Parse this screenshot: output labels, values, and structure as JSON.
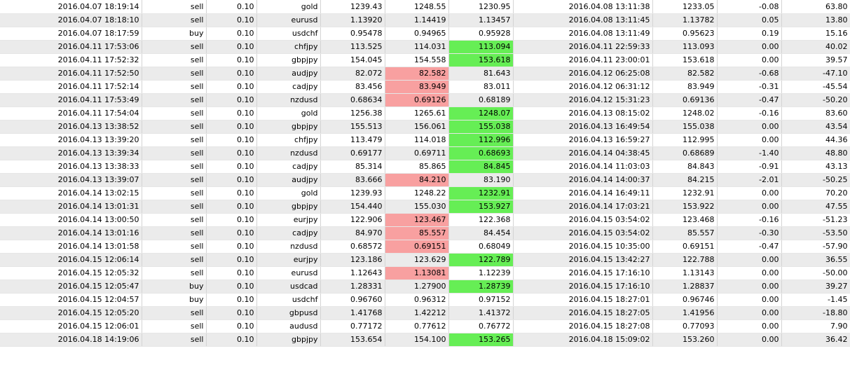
{
  "rows": [
    {
      "open_time": "2016.04.07 18:19:14",
      "type": "sell",
      "size": "0.10",
      "symbol": "gold",
      "price": "1239.43",
      "sl": "1248.55",
      "tp": "1230.95",
      "close_time": "2016.04.08 13:11:38",
      "close_price": "1233.05",
      "swap": "-0.08",
      "profit": "63.80",
      "hl": ""
    },
    {
      "open_time": "2016.04.07 18:18:10",
      "type": "sell",
      "size": "0.10",
      "symbol": "eurusd",
      "price": "1.13920",
      "sl": "1.14419",
      "tp": "1.13457",
      "close_time": "2016.04.08 13:11:45",
      "close_price": "1.13782",
      "swap": "0.05",
      "profit": "13.80",
      "hl": ""
    },
    {
      "open_time": "2016.04.07 18:17:59",
      "type": "buy",
      "size": "0.10",
      "symbol": "usdchf",
      "price": "0.95478",
      "sl": "0.94965",
      "tp": "0.95928",
      "close_time": "2016.04.08 13:11:49",
      "close_price": "0.95623",
      "swap": "0.19",
      "profit": "15.16",
      "hl": ""
    },
    {
      "open_time": "2016.04.11 17:53:06",
      "type": "sell",
      "size": "0.10",
      "symbol": "chfjpy",
      "price": "113.525",
      "sl": "114.031",
      "tp": "113.094",
      "close_time": "2016.04.11 22:59:33",
      "close_price": "113.093",
      "swap": "0.00",
      "profit": "40.02",
      "hl": "tp"
    },
    {
      "open_time": "2016.04.11 17:52:32",
      "type": "sell",
      "size": "0.10",
      "symbol": "gbpjpy",
      "price": "154.045",
      "sl": "154.558",
      "tp": "153.618",
      "close_time": "2016.04.11 23:00:01",
      "close_price": "153.618",
      "swap": "0.00",
      "profit": "39.57",
      "hl": "tp"
    },
    {
      "open_time": "2016.04.11 17:52:50",
      "type": "sell",
      "size": "0.10",
      "symbol": "audjpy",
      "price": "82.072",
      "sl": "82.582",
      "tp": "81.643",
      "close_time": "2016.04.12 06:25:08",
      "close_price": "82.582",
      "swap": "-0.68",
      "profit": "-47.10",
      "hl": "sl"
    },
    {
      "open_time": "2016.04.11 17:52:14",
      "type": "sell",
      "size": "0.10",
      "symbol": "cadjpy",
      "price": "83.456",
      "sl": "83.949",
      "tp": "83.011",
      "close_time": "2016.04.12 06:31:12",
      "close_price": "83.949",
      "swap": "-0.31",
      "profit": "-45.54",
      "hl": "sl"
    },
    {
      "open_time": "2016.04.11 17:53:49",
      "type": "sell",
      "size": "0.10",
      "symbol": "nzdusd",
      "price": "0.68634",
      "sl": "0.69126",
      "tp": "0.68189",
      "close_time": "2016.04.12 15:31:23",
      "close_price": "0.69136",
      "swap": "-0.47",
      "profit": "-50.20",
      "hl": "sl"
    },
    {
      "open_time": "2016.04.11 17:54:04",
      "type": "sell",
      "size": "0.10",
      "symbol": "gold",
      "price": "1256.38",
      "sl": "1265.61",
      "tp": "1248.07",
      "close_time": "2016.04.13 08:15:02",
      "close_price": "1248.02",
      "swap": "-0.16",
      "profit": "83.60",
      "hl": "tp"
    },
    {
      "open_time": "2016.04.13 13:38:52",
      "type": "sell",
      "size": "0.10",
      "symbol": "gbpjpy",
      "price": "155.513",
      "sl": "156.061",
      "tp": "155.038",
      "close_time": "2016.04.13 16:49:54",
      "close_price": "155.038",
      "swap": "0.00",
      "profit": "43.54",
      "hl": "tp"
    },
    {
      "open_time": "2016.04.13 13:39:20",
      "type": "sell",
      "size": "0.10",
      "symbol": "chfjpy",
      "price": "113.479",
      "sl": "114.018",
      "tp": "112.996",
      "close_time": "2016.04.13 16:59:27",
      "close_price": "112.995",
      "swap": "0.00",
      "profit": "44.36",
      "hl": "tp"
    },
    {
      "open_time": "2016.04.13 13:39:34",
      "type": "sell",
      "size": "0.10",
      "symbol": "nzdusd",
      "price": "0.69177",
      "sl": "0.69711",
      "tp": "0.68693",
      "close_time": "2016.04.14 04:38:45",
      "close_price": "0.68689",
      "swap": "-1.40",
      "profit": "48.80",
      "hl": "tp"
    },
    {
      "open_time": "2016.04.13 13:38:33",
      "type": "sell",
      "size": "0.10",
      "symbol": "cadjpy",
      "price": "85.314",
      "sl": "85.865",
      "tp": "84.845",
      "close_time": "2016.04.14 11:03:03",
      "close_price": "84.843",
      "swap": "-0.91",
      "profit": "43.13",
      "hl": "tp"
    },
    {
      "open_time": "2016.04.13 13:39:07",
      "type": "sell",
      "size": "0.10",
      "symbol": "audjpy",
      "price": "83.666",
      "sl": "84.210",
      "tp": "83.190",
      "close_time": "2016.04.14 14:00:37",
      "close_price": "84.215",
      "swap": "-2.01",
      "profit": "-50.25",
      "hl": "sl"
    },
    {
      "open_time": "2016.04.14 13:02:15",
      "type": "sell",
      "size": "0.10",
      "symbol": "gold",
      "price": "1239.93",
      "sl": "1248.22",
      "tp": "1232.91",
      "close_time": "2016.04.14 16:49:11",
      "close_price": "1232.91",
      "swap": "0.00",
      "profit": "70.20",
      "hl": "tp"
    },
    {
      "open_time": "2016.04.14 13:01:31",
      "type": "sell",
      "size": "0.10",
      "symbol": "gbpjpy",
      "price": "154.440",
      "sl": "155.030",
      "tp": "153.927",
      "close_time": "2016.04.14 17:03:21",
      "close_price": "153.922",
      "swap": "0.00",
      "profit": "47.55",
      "hl": "tp"
    },
    {
      "open_time": "2016.04.14 13:00:50",
      "type": "sell",
      "size": "0.10",
      "symbol": "eurjpy",
      "price": "122.906",
      "sl": "123.467",
      "tp": "122.368",
      "close_time": "2016.04.15 03:54:02",
      "close_price": "123.468",
      "swap": "-0.16",
      "profit": "-51.23",
      "hl": "sl"
    },
    {
      "open_time": "2016.04.14 13:01:16",
      "type": "sell",
      "size": "0.10",
      "symbol": "cadjpy",
      "price": "84.970",
      "sl": "85.557",
      "tp": "84.454",
      "close_time": "2016.04.15 03:54:02",
      "close_price": "85.557",
      "swap": "-0.30",
      "profit": "-53.50",
      "hl": "sl"
    },
    {
      "open_time": "2016.04.14 13:01:58",
      "type": "sell",
      "size": "0.10",
      "symbol": "nzdusd",
      "price": "0.68572",
      "sl": "0.69151",
      "tp": "0.68049",
      "close_time": "2016.04.15 10:35:00",
      "close_price": "0.69151",
      "swap": "-0.47",
      "profit": "-57.90",
      "hl": "sl"
    },
    {
      "open_time": "2016.04.15 12:06:14",
      "type": "sell",
      "size": "0.10",
      "symbol": "eurjpy",
      "price": "123.186",
      "sl": "123.629",
      "tp": "122.789",
      "close_time": "2016.04.15 13:42:27",
      "close_price": "122.788",
      "swap": "0.00",
      "profit": "36.55",
      "hl": "tp"
    },
    {
      "open_time": "2016.04.15 12:05:32",
      "type": "sell",
      "size": "0.10",
      "symbol": "eurusd",
      "price": "1.12643",
      "sl": "1.13081",
      "tp": "1.12239",
      "close_time": "2016.04.15 17:16:10",
      "close_price": "1.13143",
      "swap": "0.00",
      "profit": "-50.00",
      "hl": "sl"
    },
    {
      "open_time": "2016.04.15 12:05:47",
      "type": "buy",
      "size": "0.10",
      "symbol": "usdcad",
      "price": "1.28331",
      "sl": "1.27900",
      "tp": "1.28739",
      "close_time": "2016.04.15 17:16:10",
      "close_price": "1.28837",
      "swap": "0.00",
      "profit": "39.27",
      "hl": "tp"
    },
    {
      "open_time": "2016.04.15 12:04:57",
      "type": "buy",
      "size": "0.10",
      "symbol": "usdchf",
      "price": "0.96760",
      "sl": "0.96312",
      "tp": "0.97152",
      "close_time": "2016.04.15 18:27:01",
      "close_price": "0.96746",
      "swap": "0.00",
      "profit": "-1.45",
      "hl": ""
    },
    {
      "open_time": "2016.04.15 12:05:20",
      "type": "sell",
      "size": "0.10",
      "symbol": "gbpusd",
      "price": "1.41768",
      "sl": "1.42212",
      "tp": "1.41372",
      "close_time": "2016.04.15 18:27:05",
      "close_price": "1.41956",
      "swap": "0.00",
      "profit": "-18.80",
      "hl": ""
    },
    {
      "open_time": "2016.04.15 12:06:01",
      "type": "sell",
      "size": "0.10",
      "symbol": "audusd",
      "price": "0.77172",
      "sl": "0.77612",
      "tp": "0.76772",
      "close_time": "2016.04.15 18:27:08",
      "close_price": "0.77093",
      "swap": "0.00",
      "profit": "7.90",
      "hl": ""
    },
    {
      "open_time": "2016.04.18 14:19:06",
      "type": "sell",
      "size": "0.10",
      "symbol": "gbpjpy",
      "price": "153.654",
      "sl": "154.100",
      "tp": "153.265",
      "close_time": "2016.04.18 15:09:02",
      "close_price": "153.260",
      "swap": "0.00",
      "profit": "36.42",
      "hl": "tp"
    }
  ],
  "colors": {
    "stop_loss_hit": "#f8a0a0",
    "take_profit_hit": "#66ee55"
  }
}
